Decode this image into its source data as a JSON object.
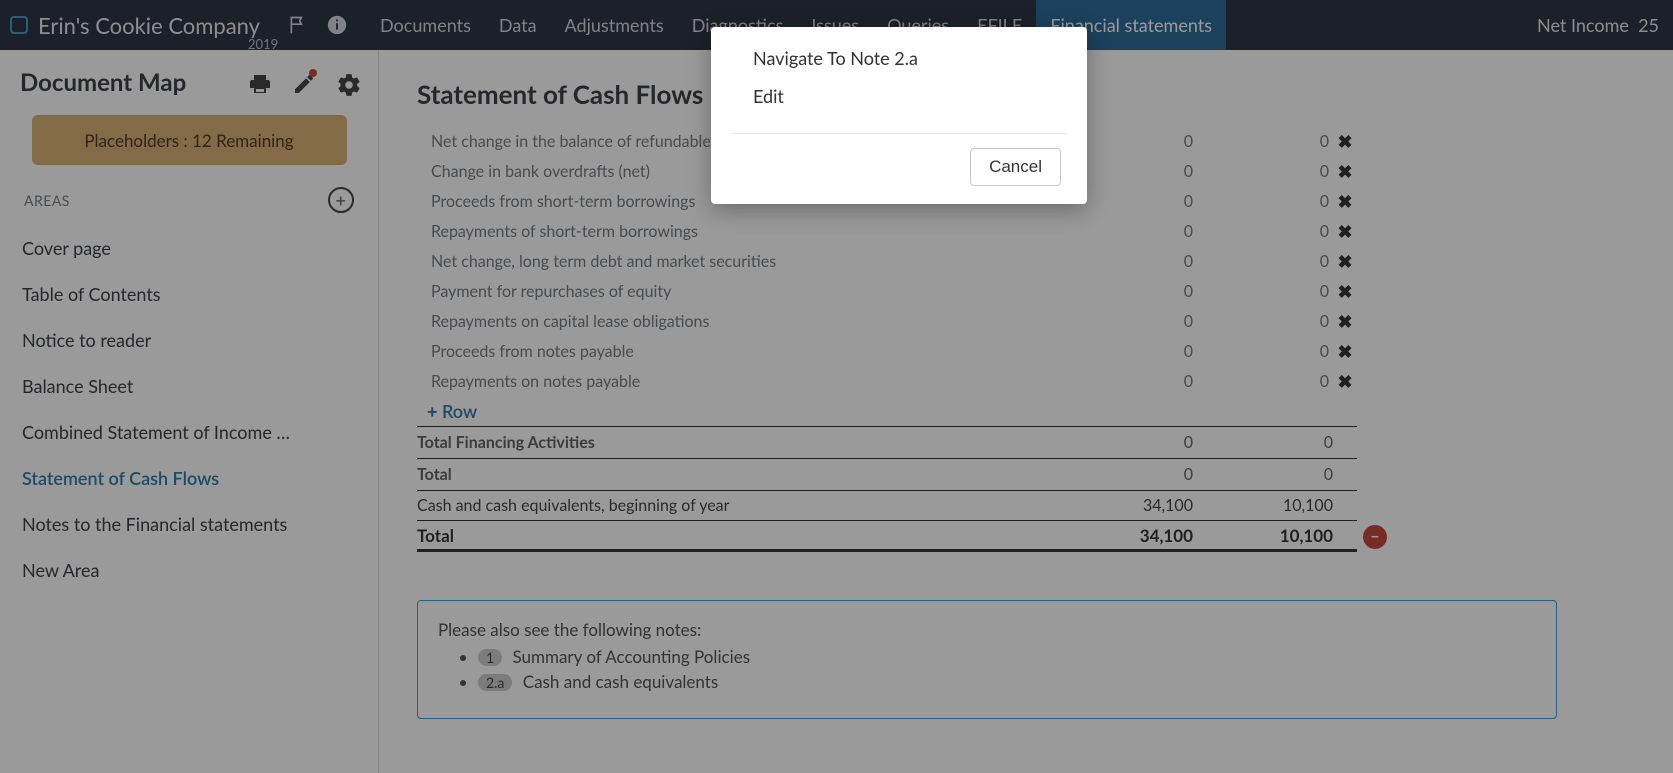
{
  "header": {
    "company": "Erin's Cookie Company",
    "year": "2019",
    "tabs": [
      "Documents",
      "Data",
      "Adjustments",
      "Diagnostics",
      "Issues",
      "Queries",
      "EFILE",
      "Financial statements"
    ],
    "active_tab": 7,
    "net_income_label": "Net Income",
    "net_income_value": "25"
  },
  "sidebar": {
    "title": "Document Map",
    "placeholders": "Placeholders : 12 Remaining",
    "areas_label": "AREAS",
    "items": [
      "Cover page",
      "Table of Contents",
      "Notice to reader",
      "Balance Sheet",
      "Combined Statement of Income …",
      "Statement of Cash Flows",
      "Notes to the Financial statements",
      "New Area"
    ],
    "active_index": 5
  },
  "content": {
    "title": "Statement of Cash Flows",
    "rows": [
      {
        "label": "Net change in the balance of refundable deposits",
        "v1": "0",
        "v2": "0"
      },
      {
        "label": "Change in bank overdrafts (net)",
        "v1": "0",
        "v2": "0"
      },
      {
        "label": "Proceeds from short-term borrowings",
        "v1": "0",
        "v2": "0"
      },
      {
        "label": "Repayments of short-term borrowings",
        "v1": "0",
        "v2": "0"
      },
      {
        "label": "Net change, long term debt and market securities",
        "v1": "0",
        "v2": "0"
      },
      {
        "label": "Payment for repurchases of equity",
        "v1": "0",
        "v2": "0"
      },
      {
        "label": "Repayments on capital lease obligations",
        "v1": "0",
        "v2": "0"
      },
      {
        "label": "Proceeds from notes payable",
        "v1": "0",
        "v2": "0"
      },
      {
        "label": "Repayments on notes payable",
        "v1": "0",
        "v2": "0"
      }
    ],
    "add_row": "Row",
    "totals": {
      "financing_label": "Total Financing Activities",
      "financing_v1": "0",
      "financing_v2": "0",
      "total_label": "Total",
      "total_v1": "0",
      "total_v2": "0",
      "beginning_label": "Cash and cash equivalents, beginning of year",
      "beginning_v1": "34,100",
      "beginning_v2": "10,100",
      "grand_label": "Total",
      "grand_v1": "34,100",
      "grand_v2": "10,100"
    },
    "notes_intro": "Please also see the following notes:",
    "note1_badge": "1",
    "note1_text": "Summary of Accounting Policies",
    "note2_badge": "2.a",
    "note2_text": "Cash and cash equivalents"
  },
  "popup": {
    "opt1": "Navigate To Note 2.a",
    "opt2": "Edit",
    "cancel": "Cancel"
  }
}
